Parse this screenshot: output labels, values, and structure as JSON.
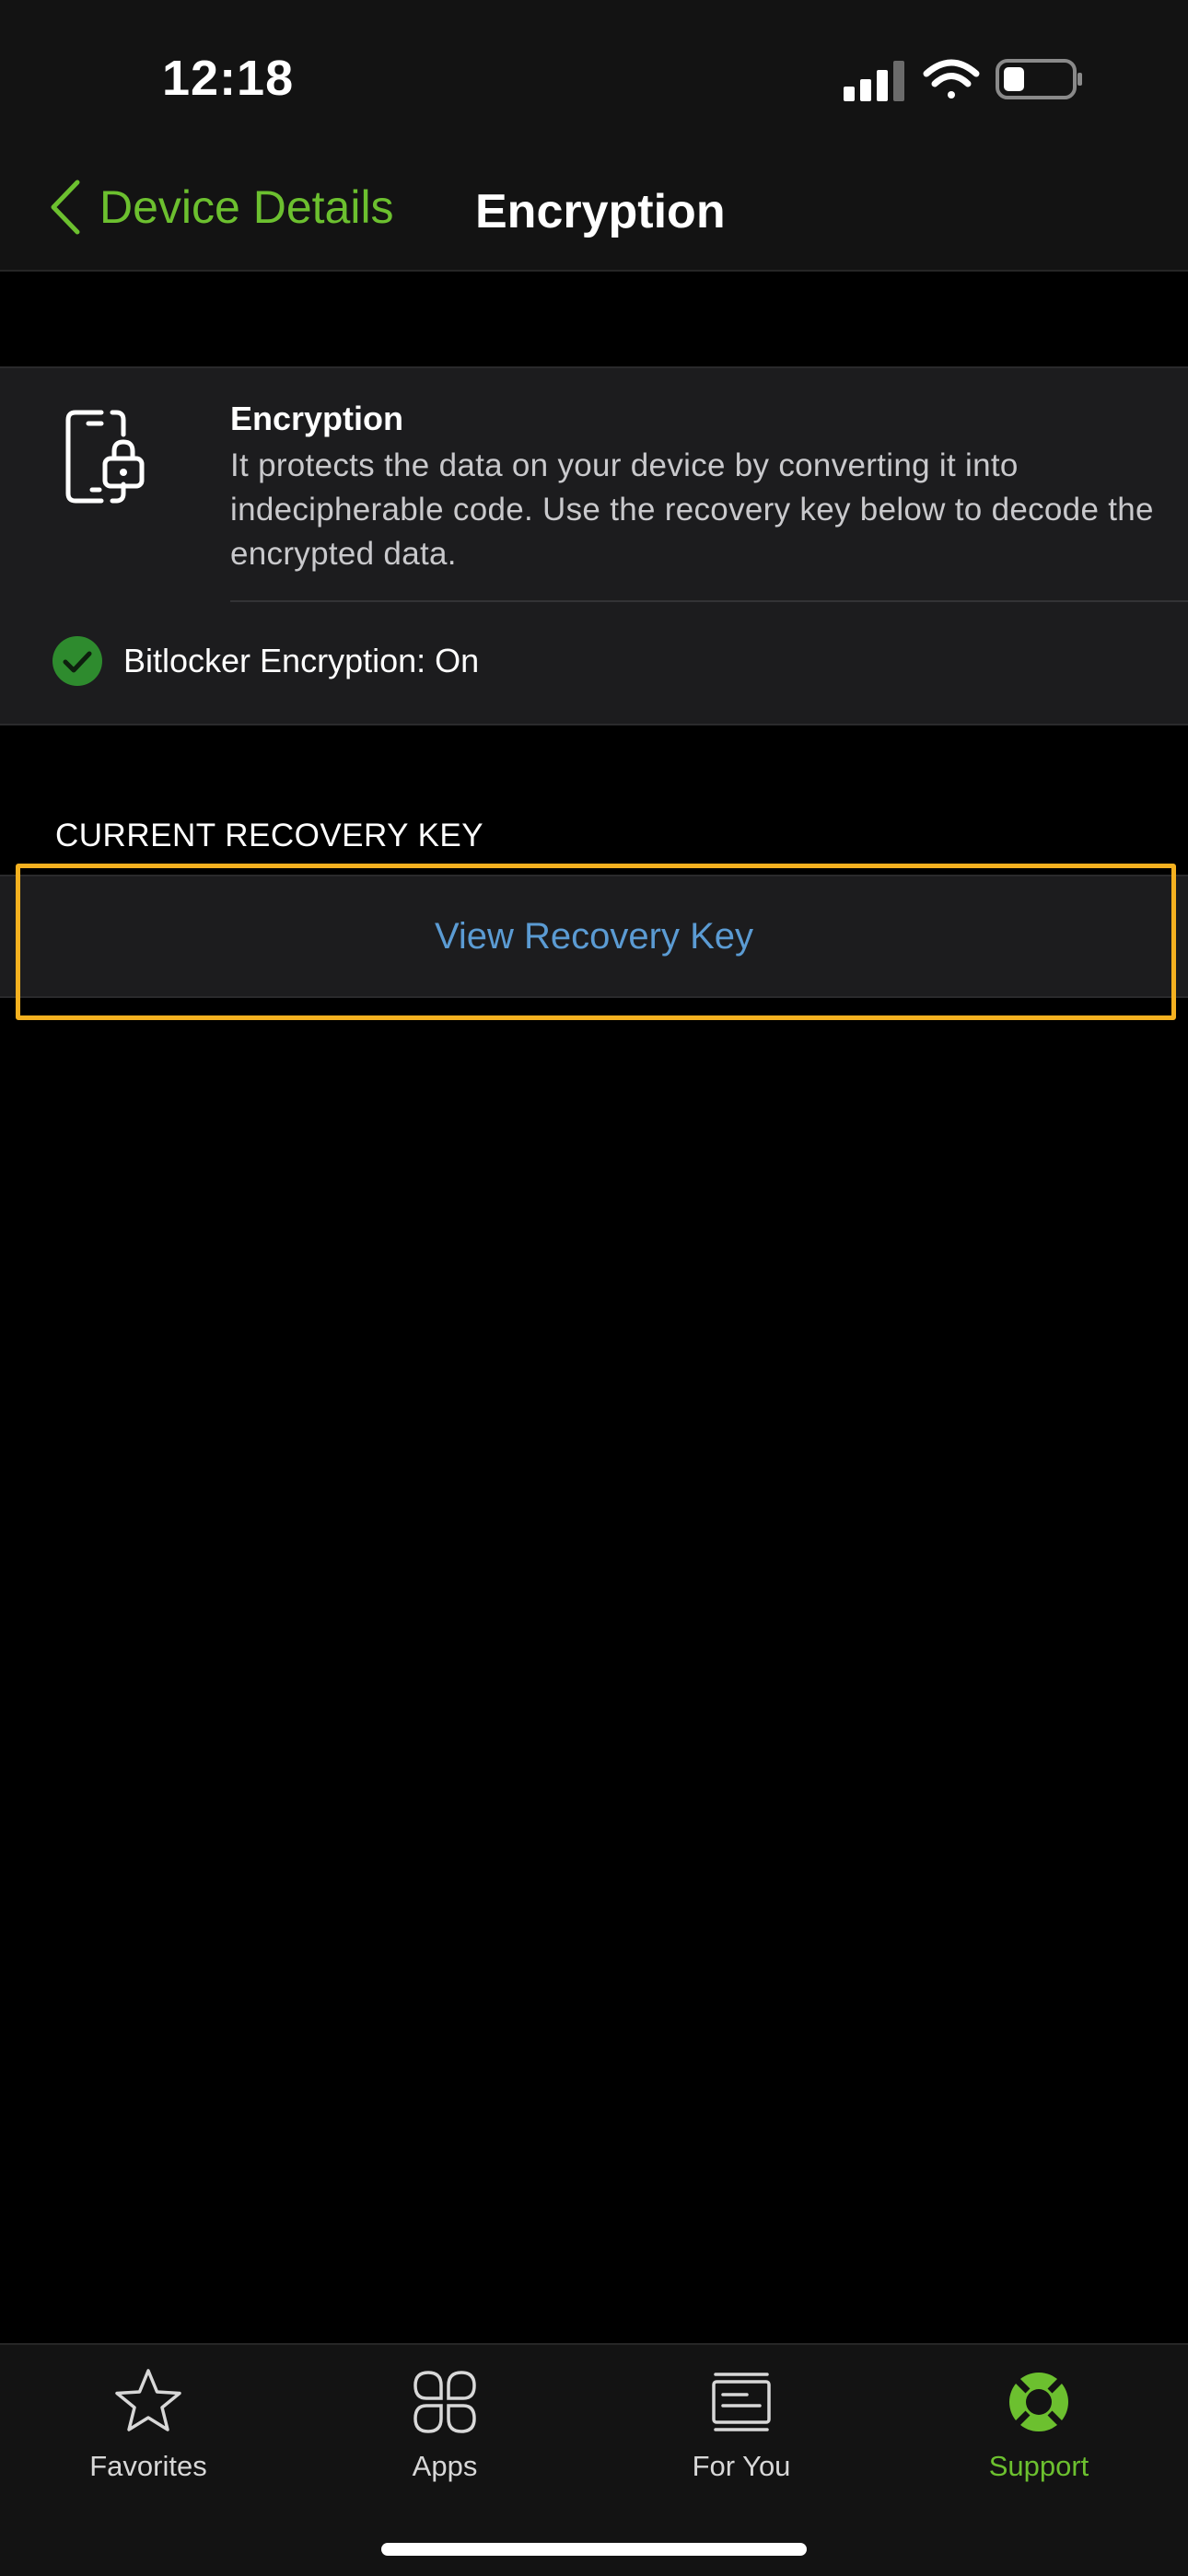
{
  "status_bar": {
    "time": "12:18",
    "icons": [
      "cellular-signal-icon",
      "wifi-icon",
      "battery-icon"
    ]
  },
  "nav": {
    "back_label": "Device Details",
    "title": "Encryption"
  },
  "encryption_card": {
    "icon": "phone-lock-icon",
    "title": "Encryption",
    "description": "It protects the data on your device by converting it into indecipherable code. Use the recovery key below to decode the encrypted data.",
    "status_icon": "checkmark-circle-icon",
    "status_label": "Bitlocker Encryption: On"
  },
  "recovery_key": {
    "section_header": "CURRENT RECOVERY KEY",
    "view_button_label": "View Recovery Key"
  },
  "tab_bar": {
    "tabs": [
      {
        "label": "Favorites",
        "icon": "star-icon",
        "active": false
      },
      {
        "label": "Apps",
        "icon": "apps-grid-icon",
        "active": false
      },
      {
        "label": "For You",
        "icon": "news-feed-icon",
        "active": false
      },
      {
        "label": "Support",
        "icon": "lifebuoy-icon",
        "active": true
      }
    ]
  },
  "colors": {
    "accent_green": "#6cc02f",
    "link_blue": "#5b9bd3",
    "highlight_orange": "#f5b120",
    "background": "#000000",
    "card": "#1c1c1e"
  }
}
